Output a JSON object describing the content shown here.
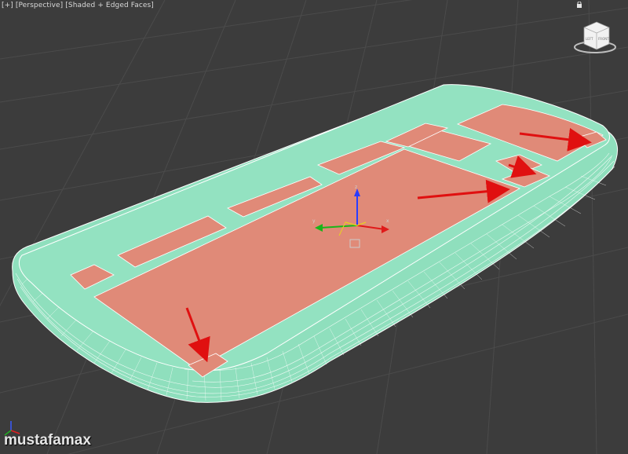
{
  "viewport": {
    "label_plus": "[+]",
    "label_view": "[Perspective]",
    "label_shading": "[Shaded + Edged Faces]"
  },
  "viewcube": {
    "face_front": "FRONT",
    "face_left": "LEFT"
  },
  "watermark": "mustafamax",
  "colors": {
    "background": "#3c3c3c",
    "grid": "#4a4a4a",
    "body_mesh": "#90e0be",
    "selected_faces": "#e08a78",
    "arrow": "#e01010",
    "wire": "#ffffff"
  },
  "icons": [
    "viewcube-icon",
    "transform-gizmo-icon",
    "axis-tripod-icon",
    "arrow-annotation-icon"
  ]
}
